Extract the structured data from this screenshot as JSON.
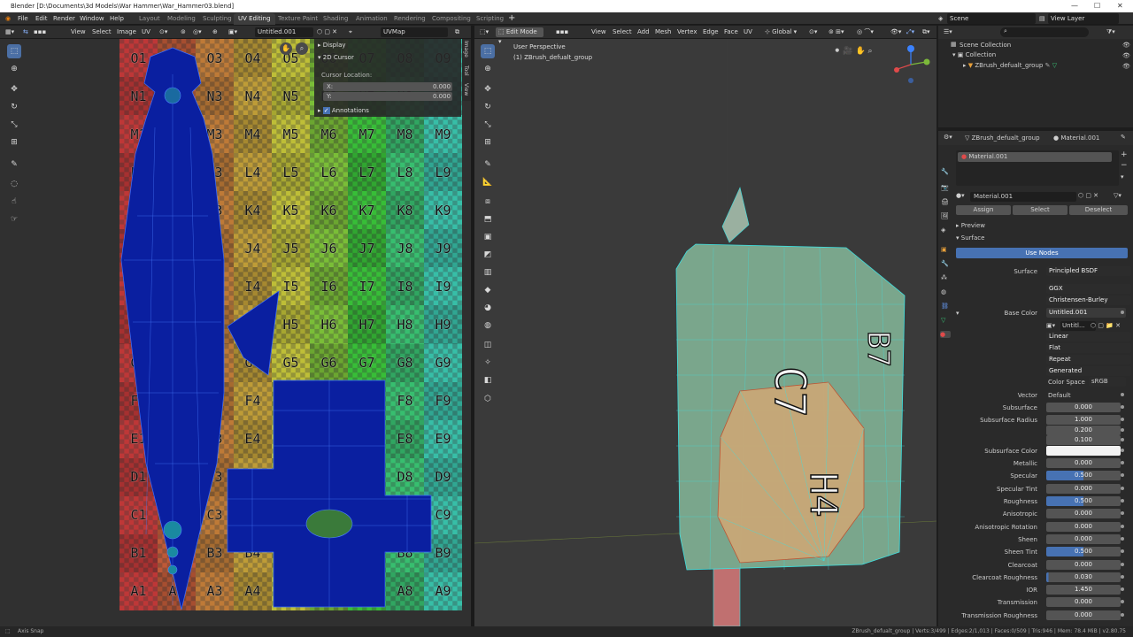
{
  "title_bar": {
    "text": "Blender [D:\\Documents\\3d Models\\War Hammer\\War_Hammer03.blend]"
  },
  "menus": [
    "File",
    "Edit",
    "Render",
    "Window",
    "Help"
  ],
  "workspaces": [
    "Layout",
    "Modeling",
    "Sculpting",
    "UV Editing",
    "Texture Paint",
    "Shading",
    "Animation",
    "Rendering",
    "Compositing",
    "Scripting"
  ],
  "scene": "Scene",
  "view_layer": "View Layer",
  "uv_editor": {
    "menus": [
      "View",
      "Select",
      "Image",
      "UV"
    ],
    "image_name": "Untitled.001",
    "uv_map": "UVMap",
    "columns": [
      "1",
      "2",
      "3",
      "4",
      "5",
      "6",
      "7",
      "8",
      "9"
    ],
    "rows": [
      "O",
      "N",
      "M",
      "L",
      "K",
      "J",
      "I",
      "H",
      "G",
      "F",
      "E",
      "D",
      "C",
      "B",
      "A"
    ],
    "n_panel": {
      "display": "Display",
      "cursor": "2D Cursor",
      "cursor_location": "Cursor Location:",
      "x_label": "X:",
      "x_val": "0.000",
      "y_label": "Y:",
      "y_val": "0.000",
      "annotations": "Annotations"
    },
    "side_tabs": [
      "Image",
      "Tool",
      "View"
    ]
  },
  "viewport": {
    "mode": "Edit Mode",
    "menus": [
      "View",
      "Select",
      "Add",
      "Mesh",
      "Vertex",
      "Edge",
      "Face",
      "UV"
    ],
    "orientation": "Global",
    "perspective": "User Perspective",
    "object": "(1) ZBrush_defualt_group"
  },
  "outliner": {
    "scene_collection": "Scene Collection",
    "collection": "Collection",
    "object": "ZBrush_defualt_group"
  },
  "properties": {
    "object": "ZBrush_defualt_group",
    "material": "Material.001",
    "slot": "Material.001",
    "mat_field": "Material.001",
    "assign": "Assign",
    "select": "Select",
    "deselect": "Deselect",
    "preview": "Preview",
    "surface_header": "Surface",
    "use_nodes": "Use Nodes",
    "surface_label": "Surface",
    "surface_val": "Principled BSDF",
    "dist": "GGX",
    "sss_method": "Christensen-Burley",
    "base_color_label": "Base Color",
    "base_color_val": "Untitled.001",
    "image_val": "Untitl...",
    "interp": "Linear",
    "proj": "Flat",
    "ext": "Repeat",
    "source": "Generated",
    "color_space_label": "Color Space",
    "color_space": "sRGB",
    "vector_label": "Vector",
    "vector_val": "Default",
    "rows": [
      {
        "label": "Subsurface",
        "val": "0.000"
      },
      {
        "label": "Subsurface Radius",
        "val": "1.000"
      },
      {
        "label": "",
        "val": "0.200"
      },
      {
        "label": "",
        "val": "0.100"
      },
      {
        "label": "Subsurface Color",
        "val": ""
      },
      {
        "label": "Metallic",
        "val": "0.000"
      },
      {
        "label": "Specular",
        "val": "0.500"
      },
      {
        "label": "Specular Tint",
        "val": "0.000"
      },
      {
        "label": "Roughness",
        "val": "0.500"
      },
      {
        "label": "Anisotropic",
        "val": "0.000"
      },
      {
        "label": "Anisotropic Rotation",
        "val": "0.000"
      },
      {
        "label": "Sheen",
        "val": "0.000"
      },
      {
        "label": "Sheen Tint",
        "val": "0.500"
      },
      {
        "label": "Clearcoat",
        "val": "0.000"
      },
      {
        "label": "Clearcoat Roughness",
        "val": "0.030"
      },
      {
        "label": "IOR",
        "val": "1.450"
      },
      {
        "label": "Transmission",
        "val": "0.000"
      },
      {
        "label": "Transmission Roughness",
        "val": "0.000"
      }
    ]
  },
  "status": {
    "left": "Axis Snap",
    "right": "ZBrush_defualt_group | Verts:3/499 | Edges:2/1,013 | Faces:0/509 | Tris:946 | Mem: 78.4 MiB | v2.80.75"
  },
  "colors": {
    "accent": "#4772b3",
    "uv_island": "#0a1fa0",
    "wire": "#3ee0e0"
  }
}
